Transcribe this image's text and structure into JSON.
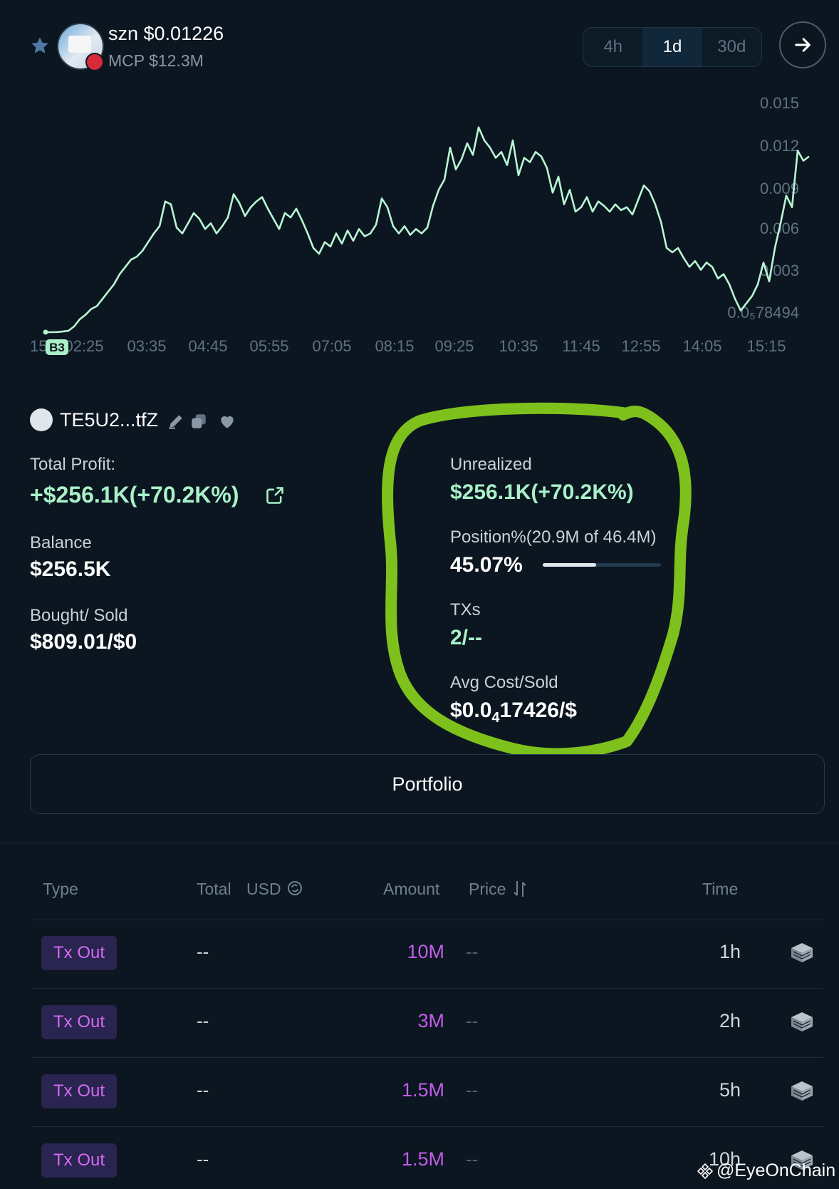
{
  "header": {
    "token_title": "szn $0.01226",
    "mcp": "MCP $12.3M",
    "timeframes": [
      {
        "label": "4h",
        "active": false
      },
      {
        "label": "1d",
        "active": true
      },
      {
        "label": "30d",
        "active": false
      }
    ],
    "icons": {
      "favorite": "star-icon",
      "next": "arrow-right-icon",
      "chain": "tron-badge-icon"
    }
  },
  "chart_data": {
    "type": "line",
    "x_tick_labels": [
      "15:",
      "02:25",
      "03:35",
      "04:45",
      "05:55",
      "07:05",
      "08:15",
      "09:25",
      "10:35",
      "11:45",
      "12:55",
      "14:05",
      "15:15"
    ],
    "y_tick_labels": [
      "0.015",
      "0.012",
      "0.009",
      "0.006",
      "0.003",
      "0.0₅78494"
    ],
    "ylim": [
      7.8494e-06,
      0.0155
    ],
    "marker_label": "B3",
    "line_color": "#b9f5d3",
    "y": [
      1e-05,
      1e-05,
      2e-05,
      5e-05,
      0.0001,
      0.0004,
      0.0009,
      0.0012,
      0.0016,
      0.0018,
      0.0023,
      0.0028,
      0.0033,
      0.004,
      0.0045,
      0.005,
      0.0052,
      0.0056,
      0.0062,
      0.0068,
      0.0073,
      0.009,
      0.0088,
      0.0072,
      0.0068,
      0.0075,
      0.0082,
      0.0078,
      0.0071,
      0.0075,
      0.0068,
      0.0073,
      0.0079,
      0.0095,
      0.0089,
      0.008,
      0.0086,
      0.009,
      0.0093,
      0.0085,
      0.0078,
      0.0071,
      0.0082,
      0.0079,
      0.0085,
      0.0077,
      0.0068,
      0.0058,
      0.0054,
      0.0062,
      0.0059,
      0.0068,
      0.0061,
      0.007,
      0.0063,
      0.0071,
      0.0066,
      0.0068,
      0.0074,
      0.0092,
      0.0086,
      0.0073,
      0.0068,
      0.0073,
      0.0067,
      0.0071,
      0.0068,
      0.0072,
      0.0087,
      0.0098,
      0.0105,
      0.0127,
      0.0112,
      0.0119,
      0.013,
      0.0122,
      0.0141,
      0.0132,
      0.0127,
      0.012,
      0.0124,
      0.0115,
      0.0132,
      0.0108,
      0.012,
      0.0117,
      0.0124,
      0.0121,
      0.0113,
      0.0096,
      0.0107,
      0.0088,
      0.0098,
      0.0083,
      0.0086,
      0.0093,
      0.0083,
      0.009,
      0.0087,
      0.0083,
      0.0088,
      0.0084,
      0.0086,
      0.0081,
      0.0091,
      0.0101,
      0.0097,
      0.0088,
      0.0076,
      0.0058,
      0.0055,
      0.0058,
      0.0051,
      0.0045,
      0.0049,
      0.0043,
      0.0048,
      0.0045,
      0.0037,
      0.004,
      0.0033,
      0.0023,
      0.0015,
      0.002,
      0.0025,
      0.0033,
      0.0048,
      0.0035,
      0.0058,
      0.0075,
      0.0094,
      0.0086,
      0.0125,
      0.0118,
      0.0121
    ]
  },
  "wallet": {
    "address": "TE5U2...tfZ",
    "icons": [
      "edit-icon",
      "copy-icon",
      "heart-icon"
    ]
  },
  "stats_left": [
    {
      "label": "Total Profit:",
      "value": "+$256.1K(+70.2K%)",
      "color": "#a9f0c8"
    },
    {
      "label": "Balance",
      "value": "$256.5K",
      "color": "#ffffff"
    },
    {
      "label": "Bought/ Sold",
      "value": "$809.01/$0",
      "color": "#ffffff"
    }
  ],
  "stats_right": {
    "unrealized_label": "Unrealized",
    "unrealized_value": "$256.1K(+70.2K%)",
    "position_label": "Position%(20.9M of 46.4M)",
    "position_value": "45.07%",
    "position_fraction": 0.4507,
    "txs_label": "TXs",
    "txs_value": "2/--",
    "avg_label": "Avg Cost/Sold",
    "avg_value_prefix": "$0.0",
    "avg_value_sub": "4",
    "avg_value_suffix": "17426/$"
  },
  "portfolio_label": "Portfolio",
  "table": {
    "headers": {
      "type": "Type",
      "total": "Total",
      "usd": "USD",
      "amount": "Amount",
      "price": "Price",
      "time": "Time"
    },
    "rows": [
      {
        "type": "Tx Out",
        "total": "--",
        "amount": "10M",
        "price": "--",
        "time": "1h"
      },
      {
        "type": "Tx Out",
        "total": "--",
        "amount": "3M",
        "price": "--",
        "time": "2h"
      },
      {
        "type": "Tx Out",
        "total": "--",
        "amount": "1.5M",
        "price": "--",
        "time": "5h"
      },
      {
        "type": "Tx Out",
        "total": "--",
        "amount": "1.5M",
        "price": "--",
        "time": "10h"
      }
    ]
  },
  "watermark": "@EyeOnChain",
  "colors": {
    "background": "#0b1620",
    "mint": "#a9f0c8",
    "purple": "#c35ce8",
    "annotation_green": "#7ec11c"
  }
}
